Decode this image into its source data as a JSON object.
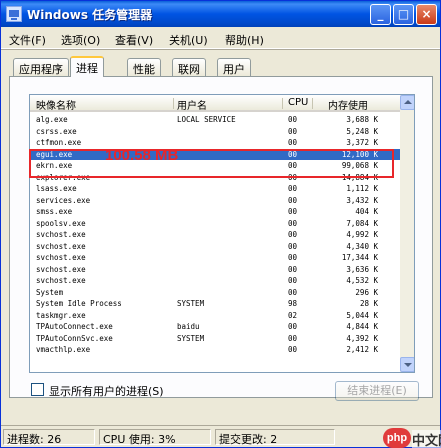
{
  "window": {
    "title": "Windows 任务管理器",
    "icon": "task-manager-icon",
    "accent": "#0054e3"
  },
  "titlebar_buttons": {
    "minimize": "_",
    "maximize": "□",
    "close": "×"
  },
  "menu": [
    "文件(F)",
    "选项(O)",
    "查看(V)",
    "关机(U)",
    "帮助(H)"
  ],
  "tabs": {
    "items": [
      "应用程序",
      "进程",
      "性能",
      "联网",
      "用户"
    ],
    "active": "进程"
  },
  "process_list": {
    "columns": [
      "映像名称",
      "用户名",
      "CPU",
      "内存使用"
    ],
    "rows": [
      {
        "name": "alg.exe",
        "user": "LOCAL SERVICE",
        "cpu": "00",
        "mem": "3,688 K"
      },
      {
        "name": "csrss.exe",
        "user": "",
        "cpu": "00",
        "mem": "5,248 K"
      },
      {
        "name": "ctfmon.exe",
        "user": "",
        "cpu": "00",
        "mem": "3,372 K"
      },
      {
        "name": "egui.exe",
        "user": "",
        "cpu": "00",
        "mem": "12,100 K",
        "selected": true
      },
      {
        "name": "ekrn.exe",
        "user": "",
        "cpu": "00",
        "mem": "99,068 K"
      },
      {
        "name": "explorer.exe",
        "user": "",
        "cpu": "00",
        "mem": "14,884 K"
      },
      {
        "name": "lsass.exe",
        "user": "",
        "cpu": "00",
        "mem": "1,112 K"
      },
      {
        "name": "services.exe",
        "user": "",
        "cpu": "00",
        "mem": "3,432 K"
      },
      {
        "name": "smss.exe",
        "user": "",
        "cpu": "00",
        "mem": "404 K"
      },
      {
        "name": "spoolsv.exe",
        "user": "",
        "cpu": "00",
        "mem": "7,084 K"
      },
      {
        "name": "svchost.exe",
        "user": "",
        "cpu": "00",
        "mem": "4,992 K"
      },
      {
        "name": "svchost.exe",
        "user": "",
        "cpu": "00",
        "mem": "4,340 K"
      },
      {
        "name": "svchost.exe",
        "user": "",
        "cpu": "00",
        "mem": "17,344 K"
      },
      {
        "name": "svchost.exe",
        "user": "",
        "cpu": "00",
        "mem": "3,636 K"
      },
      {
        "name": "svchost.exe",
        "user": "",
        "cpu": "00",
        "mem": "4,532 K"
      },
      {
        "name": "System",
        "user": "",
        "cpu": "00",
        "mem": "296 K"
      },
      {
        "name": "System Idle Process",
        "user": "SYSTEM",
        "cpu": "98",
        "mem": "28 K"
      },
      {
        "name": "taskmgr.exe",
        "user": "",
        "cpu": "02",
        "mem": "5,044 K"
      },
      {
        "name": "TPAutoConnect.exe",
        "user": "baidu",
        "cpu": "00",
        "mem": "4,844 K"
      },
      {
        "name": "TPAutoConnSvc.exe",
        "user": "SYSTEM",
        "cpu": "00",
        "mem": "4,392 K"
      },
      {
        "name": "vmacthlp.exe",
        "user": "",
        "cpu": "00",
        "mem": "2,412 K"
      }
    ]
  },
  "annotation": {
    "text": "100.58 MB",
    "color": "#e8262a"
  },
  "show_all_users": {
    "label": "显示所有用户的进程(S)",
    "checked": false
  },
  "end_process_label": "结束进程(E)",
  "status": {
    "processes": "进程数: 26",
    "cpu": "CPU 使用: 3%",
    "commit": "提交更改: 2"
  },
  "watermark": {
    "logo": "php",
    "text": "中文网"
  }
}
